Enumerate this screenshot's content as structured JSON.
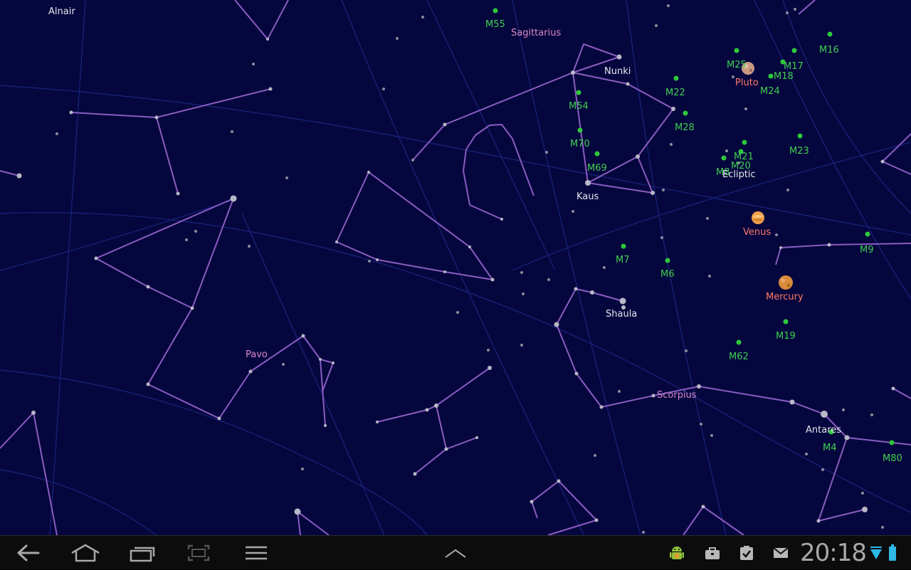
{
  "sky": {
    "stars": [
      {
        "name": "Alnair"
      },
      {
        "name": "Nunki"
      },
      {
        "name": "Kaus"
      },
      {
        "name": "Shaula"
      },
      {
        "name": "Antares"
      }
    ],
    "constellations": [
      {
        "name": "Sagittarius"
      },
      {
        "name": "Pavo"
      },
      {
        "name": "Scorpius"
      }
    ],
    "messier": [
      "M55",
      "M16",
      "M25",
      "M17",
      "M18",
      "M24",
      "M22",
      "M54",
      "M28",
      "M70",
      "M69",
      "M21",
      "M20",
      "M8",
      "M23",
      "M7",
      "M6",
      "M9",
      "M19",
      "M62",
      "M4",
      "M80"
    ],
    "planets": [
      {
        "name": "Pluto",
        "color": "#c99a82"
      },
      {
        "name": "Venus",
        "color": "#f0a04a"
      },
      {
        "name": "Mercury",
        "color": "#d98a3a"
      }
    ],
    "ecliptic_label": "Ecliptic",
    "colors": {
      "background": "#06063e",
      "constellation_line": "#8a5cc0",
      "grid_line": "#1b2b88",
      "messier": "#3fcf4f",
      "planet_label": "#ff7a66"
    }
  },
  "navbar": {
    "buttons": [
      {
        "icon": "back-icon"
      },
      {
        "icon": "home-icon"
      },
      {
        "icon": "recent-apps-icon"
      },
      {
        "icon": "screenshot-icon"
      },
      {
        "icon": "menu-icon"
      },
      {
        "icon": "chevron-up-icon"
      }
    ],
    "tray_icons": [
      "android-debug-icon",
      "briefcase-icon",
      "clipboard-check-icon",
      "gmail-icon",
      "wifi-icon",
      "battery-icon"
    ],
    "clock": "20:18"
  }
}
